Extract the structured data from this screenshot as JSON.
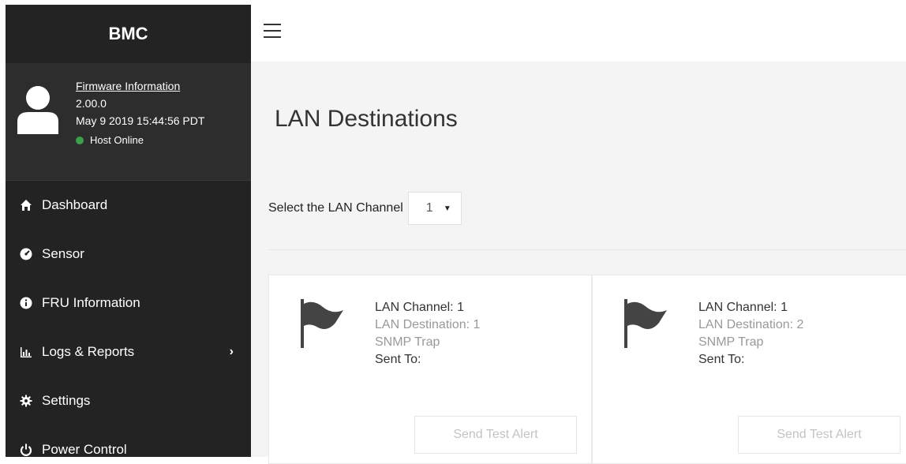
{
  "sidebar": {
    "brand": "BMC",
    "profile": {
      "firmware_link": "Firmware Information",
      "version": "2.00.0",
      "build_date": "May 9 2019 15:44:56 PDT",
      "host_status": "Host Online",
      "status_color": "#3aa04a"
    },
    "items": [
      {
        "label": "Dashboard",
        "icon": "home-icon"
      },
      {
        "label": "Sensor",
        "icon": "gauge-icon"
      },
      {
        "label": "FRU Information",
        "icon": "info-icon"
      },
      {
        "label": "Logs & Reports",
        "icon": "bar-chart-icon",
        "has_submenu": true
      },
      {
        "label": "Settings",
        "icon": "gear-icon"
      },
      {
        "label": "Power Control",
        "icon": "power-icon"
      }
    ]
  },
  "main": {
    "title": "LAN Destinations",
    "select_label": "Select the LAN Channel",
    "selected_channel": "1",
    "cards": [
      {
        "channel": "LAN Channel: 1",
        "destination": "LAN Destination: 1",
        "type": "SNMP Trap",
        "sent_to": "Sent To:",
        "button": "Send Test Alert"
      },
      {
        "channel": "LAN Channel: 1",
        "destination": "LAN Destination: 2",
        "type": "SNMP Trap",
        "sent_to": "Sent To:",
        "button": "Send Test Alert"
      }
    ]
  },
  "colors": {
    "sidebar_bg": "#232323",
    "main_bg": "#f4f4f4",
    "status_online": "#3aa04a"
  }
}
